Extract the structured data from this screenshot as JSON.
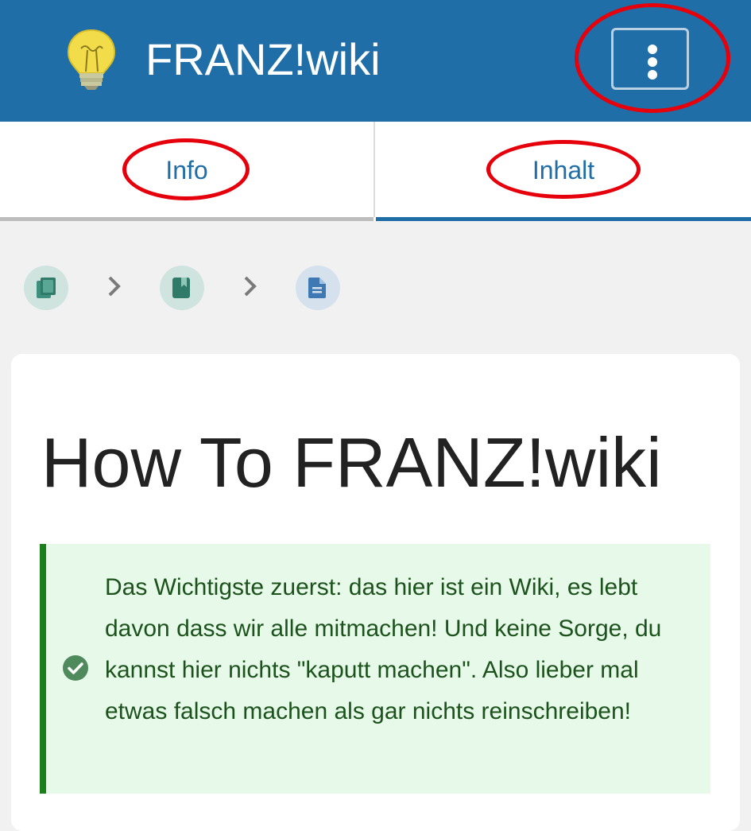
{
  "app": {
    "title": "FRANZ!wiki"
  },
  "header": {
    "logo_icon": "lightbulb-icon",
    "menu_icon": "more-vertical-icon"
  },
  "tabs": [
    {
      "label": "Info",
      "active": false
    },
    {
      "label": "Inhalt",
      "active": true
    }
  ],
  "breadcrumb": [
    {
      "icon": "books-icon"
    },
    {
      "icon": "book-icon"
    },
    {
      "icon": "page-icon"
    }
  ],
  "page": {
    "title": "How To FRANZ!wiki",
    "callout": {
      "icon": "check-circle-icon",
      "text": "Das Wichtigste zuerst: das hier ist ein Wiki, es lebt davon dass wir alle mitmachen! Und keine Sorge, du kannst hier nichts \"kaputt machen\". Also lieber mal etwas falsch machen als gar nichts reinschreiben!"
    }
  },
  "colors": {
    "header_bg": "#206ea7",
    "accent": "#206ea7",
    "annotation": "#e5000b",
    "callout_bg": "#e7f9e9",
    "callout_border": "#1b7f1b"
  }
}
